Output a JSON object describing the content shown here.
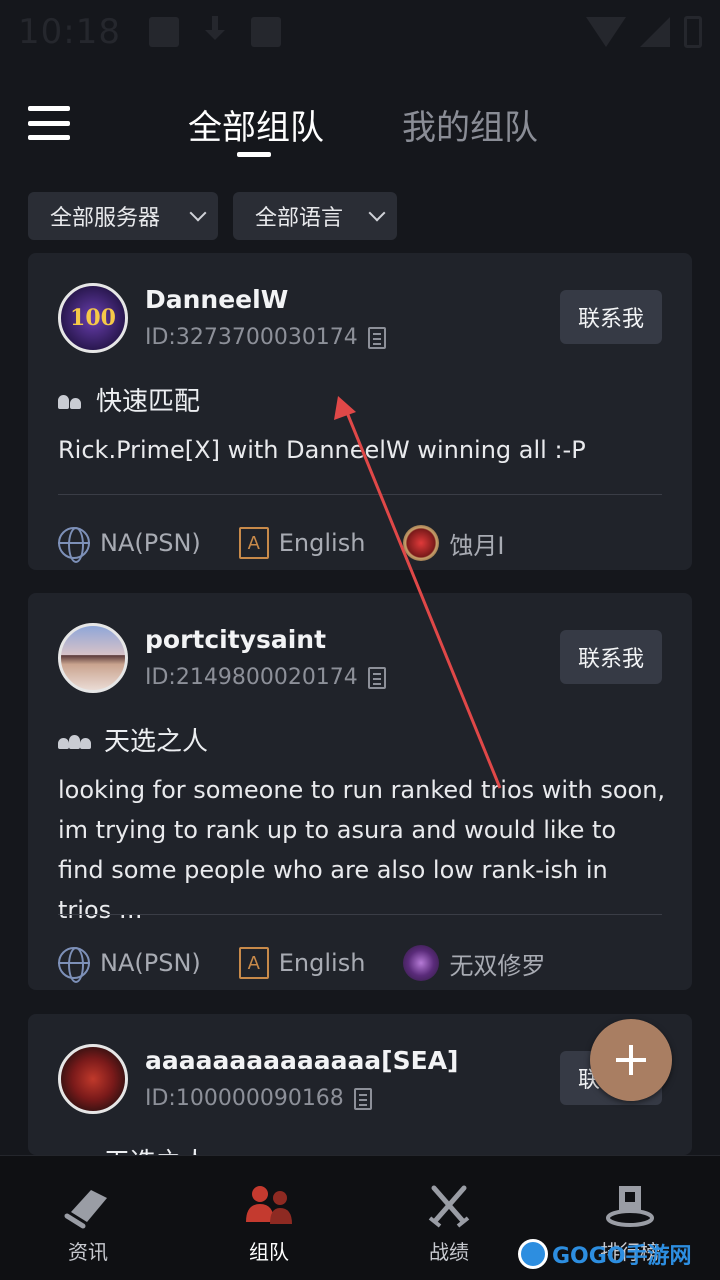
{
  "status_bar": {
    "time": "10:18"
  },
  "tabs": [
    {
      "label": "全部组队",
      "active": true
    },
    {
      "label": "我的组队",
      "active": false
    }
  ],
  "filters": {
    "server": "全部服务器",
    "language": "全部语言"
  },
  "cards": [
    {
      "username": "DanneelW",
      "id_text": "ID:3273700030174",
      "contact_label": "联系我",
      "mode": "快速匹配",
      "description": "Rick.Prime[X] with DanneelW  winning all :-P",
      "server": "NA(PSN)",
      "language": "English",
      "rank": "蚀月I",
      "avatar_text": "100"
    },
    {
      "username": "portcitysaint",
      "id_text": "ID:2149800020174",
      "contact_label": "联系我",
      "mode": "天选之人",
      "description": "looking for someone to run ranked trios with soon, im trying to rank up to asura and would like to find some people who are also low rank-ish in trios …",
      "server": "NA(PSN)",
      "language": "English",
      "rank": "无双修罗"
    },
    {
      "username": "aaaaaaaaaaaaaa[SEA]",
      "id_text": "ID:100000090168",
      "contact_label": "联系我",
      "mode": "天选之人"
    }
  ],
  "bottom_nav": [
    {
      "label": "资讯"
    },
    {
      "label": "组队",
      "active": true
    },
    {
      "label": "战绩"
    },
    {
      "label": "排行榜"
    }
  ],
  "watermark": {
    "text": "GOGO手游网"
  },
  "colors": {
    "background": "#15171c",
    "card": "#20232a",
    "fab": "#a97e62",
    "annotation_arrow": "#e04848"
  }
}
